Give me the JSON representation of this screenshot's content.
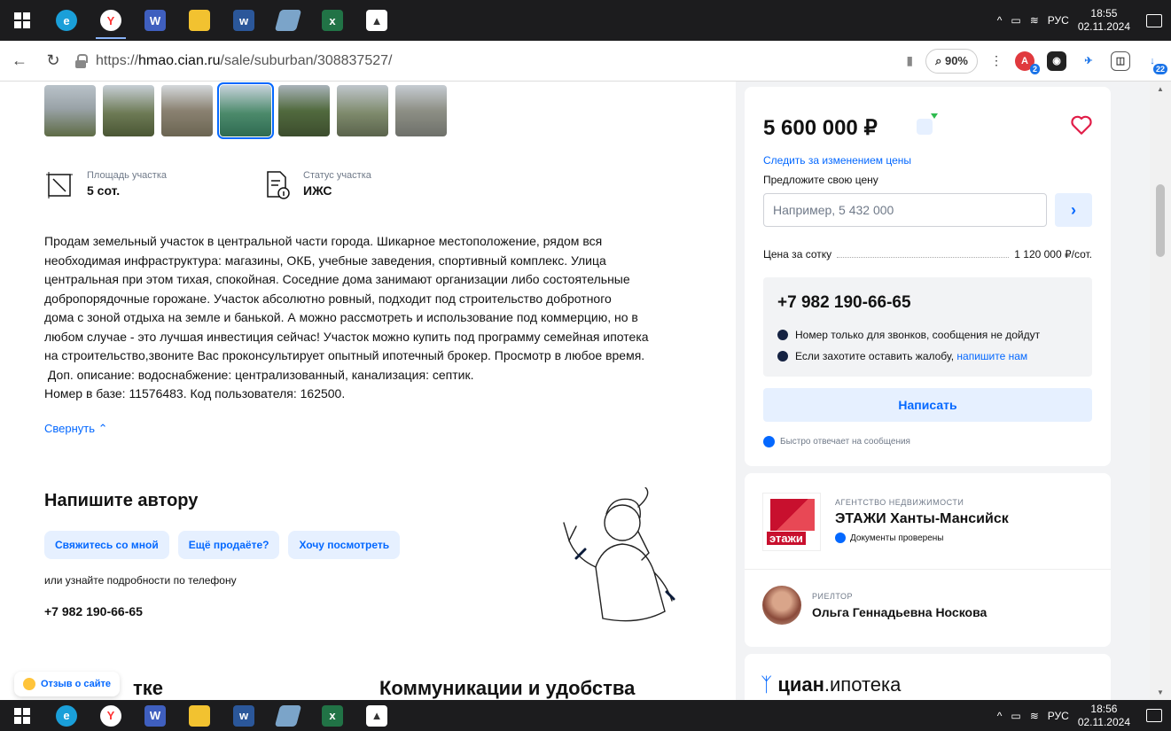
{
  "taskbar_top": {
    "apps": [
      "windows-start",
      "edge",
      "yandex-browser",
      "word-desktop",
      "file-explorer",
      "word",
      "app-notes",
      "excel",
      "photos"
    ],
    "tray": {
      "lang": "РУС",
      "time": "18:55",
      "date": "02.11.2024"
    }
  },
  "taskbar_bottom": {
    "tray": {
      "lang": "РУС",
      "time": "18:56",
      "date": "02.11.2024"
    }
  },
  "browser": {
    "url_prefix": "https://",
    "url_host": "hmao.cian.ru",
    "url_path": "/sale/suburban/308837527/",
    "zoom": "90%",
    "ext_badge_1": "2",
    "ext_badge_2": "22"
  },
  "listing": {
    "area_label": "Площадь участка",
    "area_value": "5 сот.",
    "status_label": "Статус участка",
    "status_value": "ИЖС",
    "description_lines": [
      "Продам земельный участок в центральной части города. Шикарное местоположение, рядом вся",
      "необходимая инфраструктура: магазины, ОКБ, учебные заведения, спортивный комплекс. Улица",
      "центральная при этом тихая, спокойная. Соседние дома занимают организации либо состоятельные",
      "добропорядочные горожане. Участок абсолютно ровный, подходит под строительство добротного",
      "дома с зоной отдыха на земле и банькой. А можно рассмотреть и использование под коммерцию, но в",
      "любом случае - это лучшая инвестиция сейчас! Участок можно купить под программу семейная ипотека",
      "на строительство,звоните Вас проконсультирует опытный ипотечный брокер. Просмотр в любое время.",
      " Доп. описание: водоснабжение: централизованный, канализация: септик.",
      "Номер в базе: 11576483. Код пользователя: 162500."
    ],
    "collapse_label": "Свернуть"
  },
  "write_author": {
    "title": "Напишите автору",
    "chips": [
      "Свяжитесь со мной",
      "Ещё продаёте?",
      "Хочу посмотреть"
    ],
    "or_phone": "или узнайте подробности по телефону",
    "phone": "+7 982 190-66-65"
  },
  "bottom": {
    "feedback": "Отзыв о сайте",
    "section_left": "тке",
    "section_right": "Коммуникации и удобства"
  },
  "price_card": {
    "price": "5 600 000 ₽",
    "follow": "Следить за изменением цены",
    "offer_label": "Предложите свою цену",
    "offer_placeholder": "Например, 5 432 000",
    "per_sotka_label": "Цена за сотку",
    "per_sotka_value": "1 120 000 ₽/сот.",
    "phone": "+7 982 190-66-65",
    "calls_only": "Номер только для звонков, сообщения не дойдут",
    "complaint_prefix": "Если захотите оставить жалобу,",
    "complaint_link": "напишите нам",
    "write_button": "Написать",
    "fast_reply": "Быстро отвечает на сообщения"
  },
  "agency": {
    "kind": "АГЕНТСТВО НЕДВИЖИМОСТИ",
    "name": "ЭТАЖИ Ханты-Мансийск",
    "verified": "Документы проверены",
    "logo_text": "этажи",
    "realtor_kind": "РИЕЛТОР",
    "realtor_name": "Ольга Геннадьевна Носкова"
  },
  "ipoteka": {
    "brand": "циан",
    "suffix": ".ипотека"
  },
  "colors": {
    "accent": "#0468ff",
    "brand_red": "#c8102e",
    "taskbar": "#1c1c1e"
  }
}
